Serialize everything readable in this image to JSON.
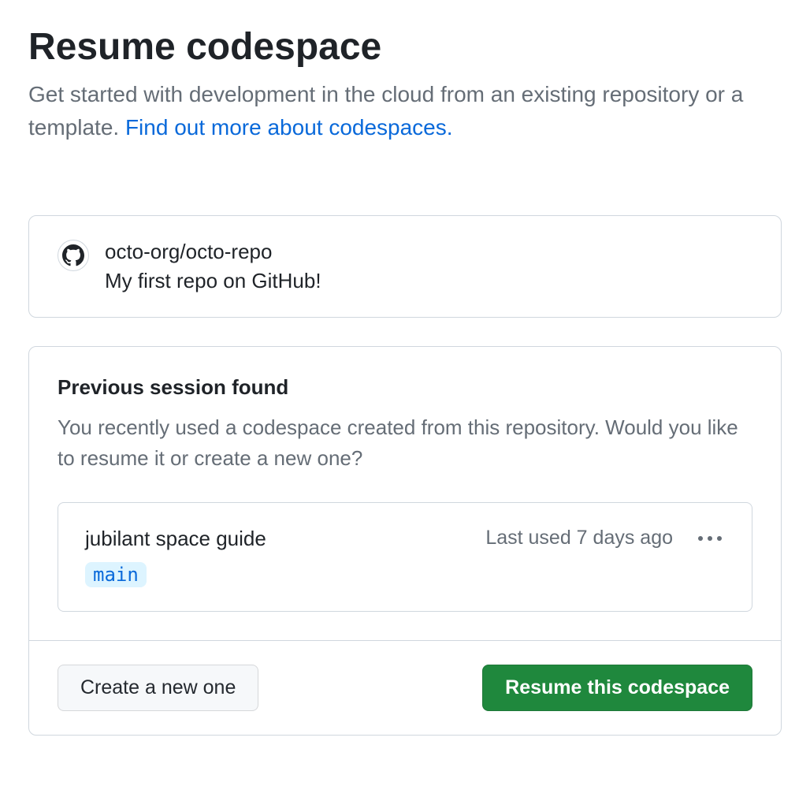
{
  "header": {
    "title": "Resume codespace",
    "subtitle_text": "Get started with development in the cloud from an existing repository or a template. ",
    "subtitle_link": "Find out more about codespaces."
  },
  "repo": {
    "full_name": "octo-org/octo-repo",
    "description": "My first repo on GitHub!"
  },
  "session": {
    "title": "Previous session found",
    "description": "You recently used a codespace created from this repository. Would you like to resume it or create a new one?",
    "codespace": {
      "name": "jubilant space guide",
      "branch": "main",
      "last_used": "Last used 7 days ago"
    }
  },
  "actions": {
    "create_new": "Create a new one",
    "resume": "Resume this codespace"
  }
}
